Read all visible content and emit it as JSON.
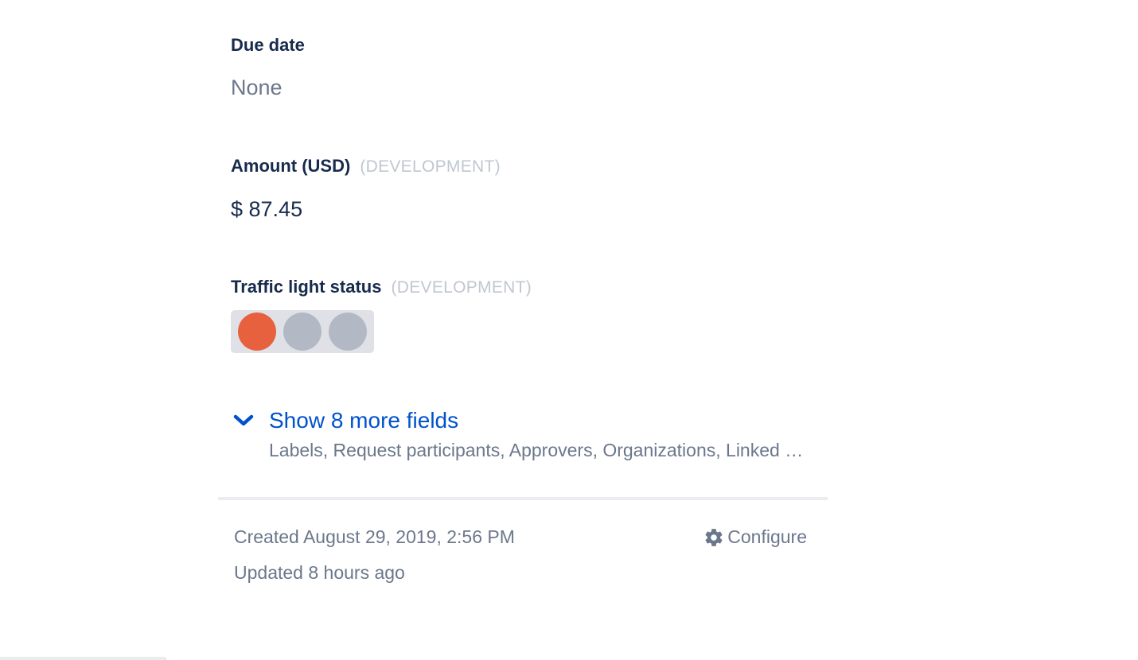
{
  "fields": {
    "due_date": {
      "label": "Due date",
      "value": "None"
    },
    "amount": {
      "label": "Amount (USD)",
      "tag": "(DEVELOPMENT)",
      "value": "$ 87.45"
    },
    "traffic_light": {
      "label": "Traffic light status",
      "tag": "(DEVELOPMENT)",
      "active_index": 0
    }
  },
  "more_fields": {
    "title": "Show 8 more fields",
    "summary": "Labels, Request participants, Approvers, Organizations, Linked issues, Components, Fix versions, Priority"
  },
  "meta": {
    "created": "Created August 29, 2019, 2:56 PM",
    "updated": "Updated 8 hours ago",
    "configure_label": "Configure"
  },
  "colors": {
    "active_light": "#e8613f",
    "inactive_light": "#b3b9c4",
    "link": "#0052cc"
  },
  "icons": [
    "chevron-down-icon",
    "gear-icon"
  ]
}
